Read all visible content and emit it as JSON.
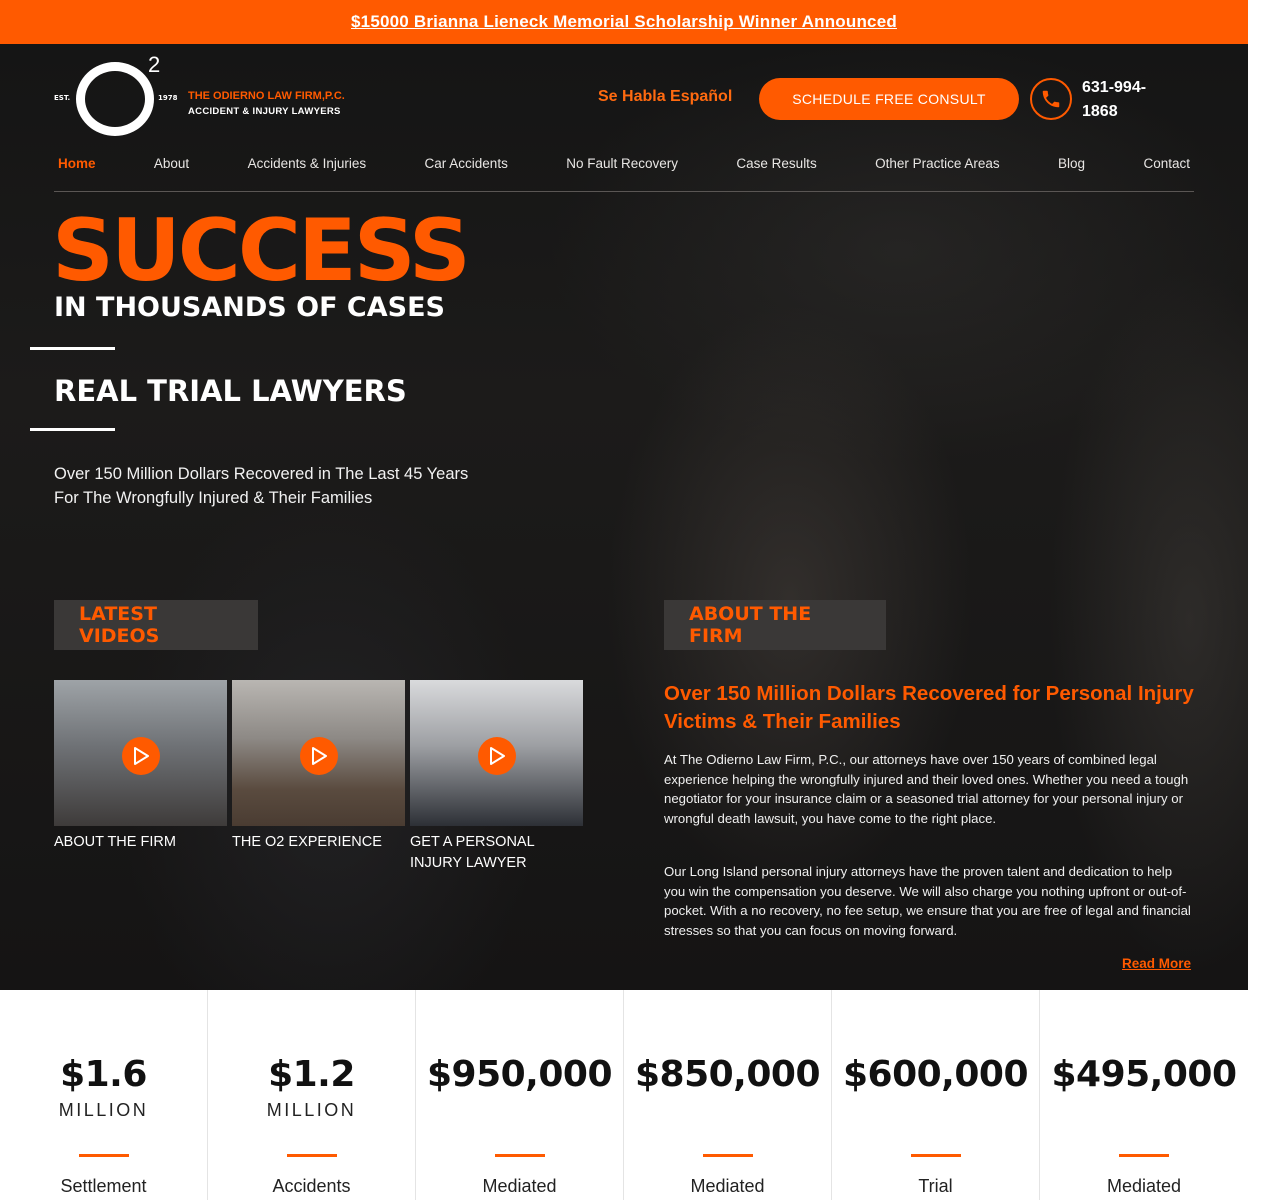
{
  "banner": {
    "text": "$15000 Brianna Lieneck Memorial Scholarship Winner Announced"
  },
  "logo": {
    "est": "EST.",
    "year": "1978",
    "sup": "2",
    "firm_name": "THE ODIERNO LAW FIRM,P.C.",
    "tagline": "ACCIDENT & INJURY LAWYERS"
  },
  "header": {
    "espanol": "Se Habla Español",
    "consult_label": "SCHEDULE FREE CONSULT",
    "phone": "631-994-1868"
  },
  "nav": {
    "items": [
      {
        "label": "Home",
        "active": true
      },
      {
        "label": "About"
      },
      {
        "label": "Accidents & Injuries"
      },
      {
        "label": "Car Accidents"
      },
      {
        "label": "No Fault Recovery"
      },
      {
        "label": "Case Results"
      },
      {
        "label": "Other Practice Areas"
      },
      {
        "label": "Blog"
      },
      {
        "label": "Contact"
      }
    ]
  },
  "hero": {
    "headline": "SUCCESS",
    "subhead": "IN THOUSANDS OF CASES",
    "tagline": "REAL TRIAL LAWYERS",
    "description": "Over 150 Million Dollars Recovered in The Last 45 Years For The Wrongfully Injured & Their Families"
  },
  "videos": {
    "title": "LATEST VIDEOS",
    "items": [
      {
        "caption": "ABOUT THE FIRM"
      },
      {
        "caption": "THE O2 EXPERIENCE"
      },
      {
        "caption": "GET A PERSONAL INJURY LAWYER"
      }
    ]
  },
  "about": {
    "title": "ABOUT THE FIRM",
    "heading": "Over 150 Million Dollars Recovered for Personal Injury Victims & Their Families",
    "p1": "At The Odierno Law Firm, P.C., our attorneys have over 150 years of combined legal experience helping the wrongfully injured and their loved ones. Whether you need a tough negotiator for your insurance claim or a seasoned trial attorney for your personal injury or wrongful death lawsuit, you have come to the right place.",
    "p2": "Our Long Island personal injury attorneys have the proven talent and dedication to help you win the compensation you deserve. We will also charge you nothing upfront or out-of-pocket. With a no recovery, no fee setup, we ensure that you are free of legal and financial stresses so that you can focus on moving forward.",
    "read_more": "Read More"
  },
  "stats": [
    {
      "amount": "$1.6",
      "unit": "MILLION",
      "label": "Settlement"
    },
    {
      "amount": "$1.2",
      "unit": "MILLION",
      "label": "Accidents"
    },
    {
      "amount": "$950,000",
      "unit": "",
      "label": "Mediated"
    },
    {
      "amount": "$850,000",
      "unit": "",
      "label": "Mediated"
    },
    {
      "amount": "$600,000",
      "unit": "",
      "label": "Trial"
    },
    {
      "amount": "$495,000",
      "unit": "",
      "label": "Mediated"
    }
  ],
  "colors": {
    "accent": "#ff5a00",
    "dark": "#161515",
    "tab_bg": "#3a3837"
  }
}
